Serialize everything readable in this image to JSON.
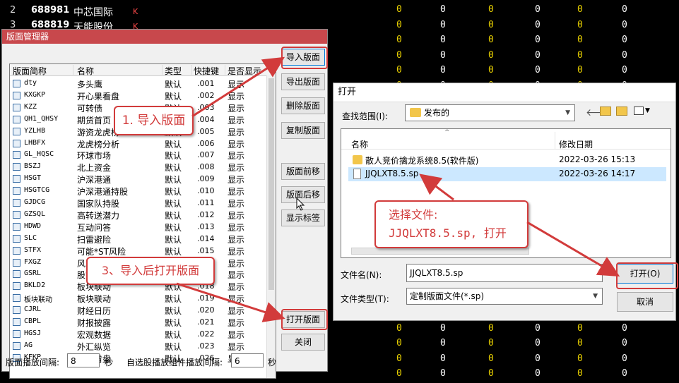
{
  "background": {
    "rows": [
      {
        "num": "2",
        "code": "688981",
        "name": "中芯国际",
        "mark": "K"
      },
      {
        "num": "3",
        "code": "688819",
        "name": "天能股份",
        "mark": "K"
      }
    ],
    "zero": "0",
    "zero_rows": 25,
    "yellow_cols": 3,
    "white_cols": 3
  },
  "manager": {
    "title": "版面管理器",
    "columns": [
      "版面简称",
      "名称",
      "类型",
      "快捷键",
      "是否显示"
    ],
    "rows": [
      {
        "abbr": "dty",
        "name": "多头鹰",
        "type": "默认",
        "key": ".001",
        "show": "显示"
      },
      {
        "abbr": "KXGKP",
        "name": "开心果看盘",
        "type": "默认",
        "key": ".002",
        "show": "显示"
      },
      {
        "abbr": "KZZ",
        "name": "可转债",
        "type": "默认",
        "key": ".003",
        "show": "显示"
      },
      {
        "abbr": "QH1_QHSY",
        "name": "期货首页",
        "type": "默认",
        "key": ".004",
        "show": "显示"
      },
      {
        "abbr": "YZLHB",
        "name": "游资龙虎榜",
        "type": "默认",
        "key": ".005",
        "show": "显示"
      },
      {
        "abbr": "LHBFX",
        "name": "龙虎榜分析",
        "type": "默认",
        "key": ".006",
        "show": "显示"
      },
      {
        "abbr": "GL_HQSC",
        "name": "环球市场",
        "type": "默认",
        "key": ".007",
        "show": "显示"
      },
      {
        "abbr": "BSZJ",
        "name": "北上资金",
        "type": "默认",
        "key": ".008",
        "show": "显示"
      },
      {
        "abbr": "HSGT",
        "name": "沪深港通",
        "type": "默认",
        "key": ".009",
        "show": "显示"
      },
      {
        "abbr": "HSGTCG",
        "name": "沪深港通持股",
        "type": "默认",
        "key": ".010",
        "show": "显示"
      },
      {
        "abbr": "GJDCG",
        "name": "国家队持股",
        "type": "默认",
        "key": ".011",
        "show": "显示"
      },
      {
        "abbr": "GZSQL",
        "name": "高转送潜力",
        "type": "默认",
        "key": ".012",
        "show": "显示"
      },
      {
        "abbr": "HDWD",
        "name": "互动问答",
        "type": "默认",
        "key": ".013",
        "show": "显示"
      },
      {
        "abbr": "SLC",
        "name": "扫雷避险",
        "type": "默认",
        "key": ".014",
        "show": "显示"
      },
      {
        "abbr": "STFX",
        "name": "可能*ST风险",
        "type": "默认",
        "key": ".015",
        "show": "显示"
      },
      {
        "abbr": "FXGZ",
        "name": "风险关注",
        "type": "默认",
        "key": ".016",
        "show": "显示"
      },
      {
        "abbr": "GSRL",
        "name": "股市日历",
        "type": "默认",
        "key": ".017",
        "show": "显示"
      },
      {
        "abbr": "BKLD2",
        "name": "板块联动",
        "type": "默认",
        "key": ".018",
        "show": "显示"
      },
      {
        "abbr": "板块联动",
        "name": "板块联动",
        "type": "默认",
        "key": ".019",
        "show": "显示"
      },
      {
        "abbr": "CJRL",
        "name": "财经日历",
        "type": "默认",
        "key": ".020",
        "show": "显示"
      },
      {
        "abbr": "CBPL",
        "name": "财报披露",
        "type": "默认",
        "key": ".021",
        "show": "显示"
      },
      {
        "abbr": "HGSJ",
        "name": "宏观数据",
        "type": "默认",
        "key": ".022",
        "show": "显示"
      },
      {
        "abbr": "AG",
        "name": "外汇纵览",
        "type": "默认",
        "key": ".023",
        "show": "显示"
      },
      {
        "abbr": "KFKP",
        "name": "宽屏看盘",
        "type": "默认",
        "key": ".026",
        "show": "显示"
      }
    ],
    "buttons": {
      "import": "导入版面",
      "export": "导出版面",
      "delete": "删除版面",
      "copy": "复制版面",
      "move_up": "版面前移",
      "move_down": "版面后移",
      "show_tab": "显示标签",
      "open": "打开版面",
      "close": "关闭"
    },
    "footer": {
      "interval_label": "版面播放间隔:",
      "interval_value": "8",
      "interval_unit": "秒",
      "component_label": "自选股播放组件播放间隔:",
      "component_value": "6",
      "component_unit": "秒"
    }
  },
  "open_dialog": {
    "title": "打开",
    "look_in_label": "查找范围(I):",
    "look_in_value": "发布的",
    "col_name": "名称",
    "col_date": "修改日期",
    "files": [
      {
        "name": "散人竞价擒龙系统8.5(软件版)",
        "date": "2022-03-26 15:13",
        "icon": "folder-icon"
      },
      {
        "name": "JJQLXT8.5.sp",
        "date": "2022-03-26 14:17",
        "icon": "file-icon"
      }
    ],
    "filename_label": "文件名(N):",
    "filename_value": "JJQLXT8.5.sp",
    "filetype_label": "文件类型(T):",
    "filetype_value": "定制版面文件(*.sp)",
    "open_button": "打开(O)",
    "cancel_button": "取消"
  },
  "annotations": {
    "step1": "1. 导入版面",
    "step2_line1": "选择文件:",
    "step2_line2": "JJQLXT8.5.sp, 打开",
    "step3": "3、导入后打开版面"
  },
  "colors": {
    "annotation_red": "#d23b3b",
    "title_red": "#c8484c",
    "zero_yellow": "#e8d000"
  }
}
